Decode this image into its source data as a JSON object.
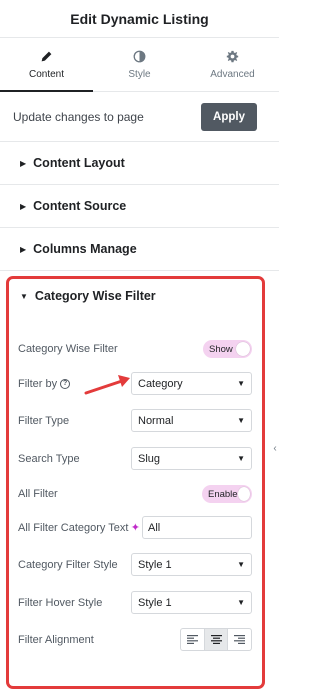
{
  "header": {
    "title": "Edit Dynamic Listing"
  },
  "tabs": [
    {
      "label": "Content",
      "icon": "pencil-icon",
      "active": true
    },
    {
      "label": "Style",
      "icon": "half-circle-icon",
      "active": false
    },
    {
      "label": "Advanced",
      "icon": "gear-icon",
      "active": false
    }
  ],
  "apply_row": {
    "text": "Update changes to page",
    "button": "Apply"
  },
  "sections": [
    {
      "label": "Content Layout"
    },
    {
      "label": "Content Source"
    },
    {
      "label": "Columns Manage"
    }
  ],
  "category_section": {
    "title": "Category Wise Filter",
    "fields": {
      "category_wise_filter": {
        "label": "Category Wise Filter",
        "toggle": "Show"
      },
      "filter_by": {
        "label": "Filter by",
        "value": "Category"
      },
      "filter_type": {
        "label": "Filter Type",
        "value": "Normal"
      },
      "search_type": {
        "label": "Search Type",
        "value": "Slug"
      },
      "all_filter": {
        "label": "All Filter",
        "toggle": "Enable"
      },
      "all_filter_text": {
        "label": "All Filter Category Text",
        "value": "All"
      },
      "category_filter_style": {
        "label": "Category Filter Style",
        "value": "Style 1"
      },
      "filter_hover_style": {
        "label": "Filter Hover Style",
        "value": "Style 1"
      },
      "filter_alignment": {
        "label": "Filter Alignment",
        "options": [
          "left",
          "center",
          "right"
        ],
        "selected": "center"
      }
    }
  },
  "colors": {
    "highlight": "#e33b3b",
    "toggle_bg": "#f4d2f0",
    "apply_bg": "#515962"
  }
}
